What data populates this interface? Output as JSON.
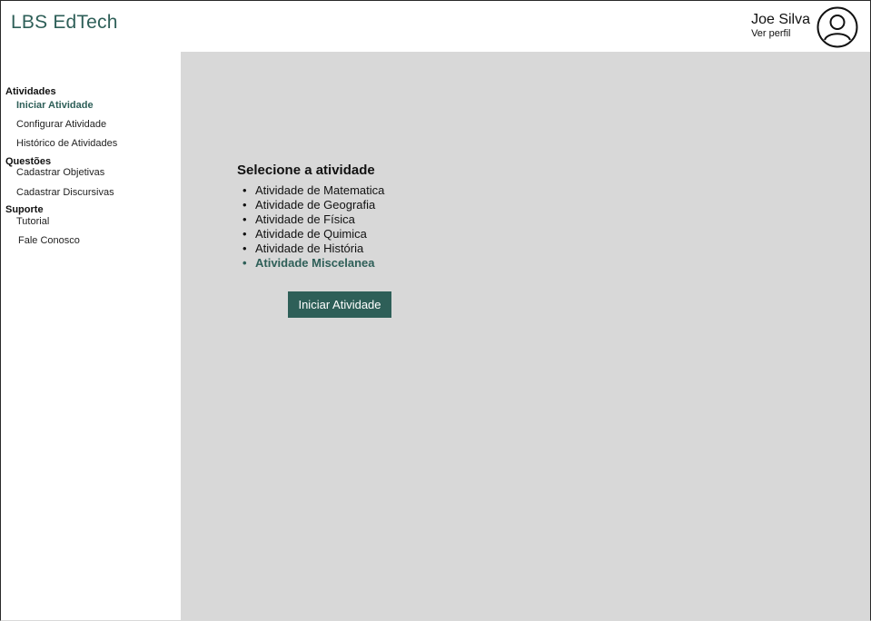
{
  "app": {
    "title": "LBS EdTech"
  },
  "user": {
    "name": "Joe Silva",
    "profile_link": "Ver perfil",
    "avatar_icon": "user-circle-icon"
  },
  "sidebar": {
    "sections": [
      {
        "label": "Atividades",
        "items": [
          {
            "label": "Iniciar Atividade",
            "active": true
          },
          {
            "label": "Configurar Atividade"
          },
          {
            "label": "Histórico de Atividades"
          }
        ]
      },
      {
        "label": "Questões",
        "items": [
          {
            "label": "Cadastrar Objetivas"
          },
          {
            "label": "Cadastrar Discursivas"
          }
        ]
      },
      {
        "label": "Suporte",
        "items": [
          {
            "label": "Tutorial"
          },
          {
            "label": "Fale Conosco"
          }
        ]
      }
    ]
  },
  "main": {
    "title": "Selecione a atividade",
    "activities": [
      "Atividade de Matematica",
      "Atividade de Geografia",
      "Atividade de Física",
      "Atividade de Quimica",
      "Atividade de História",
      "Atividade Miscelanea"
    ],
    "selected_activity": "Atividade Miscelanea",
    "start_button": "Iniciar Atividade"
  },
  "colors": {
    "accent": "#2e5f58",
    "content_bg": "#d8d8d8",
    "sidebar_bg": "#ffffff"
  }
}
